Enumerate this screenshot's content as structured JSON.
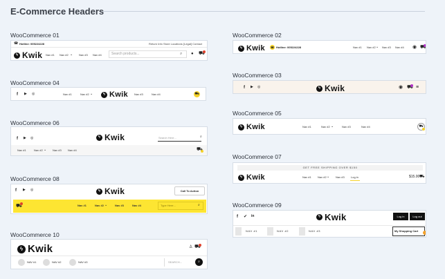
{
  "page": {
    "title": "E-Commerce Headers"
  },
  "labels": {
    "h01": "WooCommerce 01",
    "h02": "WooCommerce 02",
    "h03": "WooCommerce 03",
    "h04": "WooCommerce 04",
    "h05": "WooCommerce 05",
    "h06": "WooCommerce 06",
    "h07": "WooCommerce 07",
    "h08": "WooCommerce 08",
    "h09": "WooCommerce 09",
    "h10": "WooCommerce 10"
  },
  "brand": "Kwik",
  "nav": {
    "n1": "Nav #1",
    "n2": "Nav #2",
    "n3": "Nav #3",
    "n4": "Nav #4",
    "c1": "NAV #1",
    "c2": "NAV #2",
    "c3": "NAV #3"
  },
  "h01": {
    "hotline": "Hotline: 005224228",
    "return_info": "Return Info",
    "store_locations": "Store Locations",
    "legal_contact": "[Legal] Contact",
    "search_placeholder": "Search products..."
  },
  "h02": {
    "hotline": "Hotline: 005224228"
  },
  "h06": {
    "search_placeholder": "Search Here..."
  },
  "h07": {
    "promo": "GET FREE SHIPPING OVER $150",
    "login": "Log in",
    "price": "$15.00"
  },
  "h08": {
    "cta": "Call To Action",
    "search_placeholder": "Type Here..."
  },
  "h09": {
    "login": "Log in",
    "logout": "Log out",
    "cart": "My Shopping Cart"
  },
  "h10": {
    "search_placeholder": "SEARCH..."
  },
  "colors": {
    "accent_yellow": "#f4d22a",
    "banner_yellow": "#fde532",
    "cream": "#f9f3ec",
    "badge_red": "#e0402c",
    "badge_purple": "#b02fc4"
  }
}
